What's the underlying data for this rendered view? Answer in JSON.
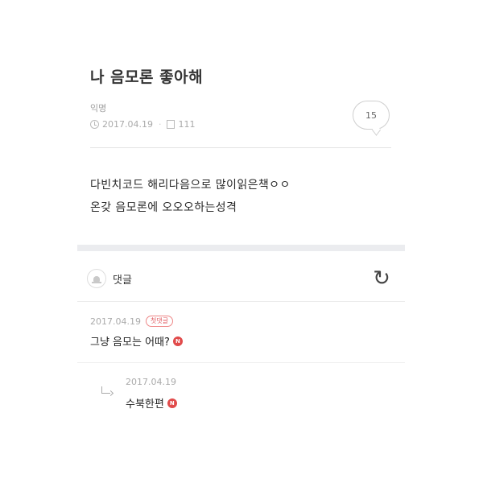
{
  "post": {
    "title": "나 음모론 좋아해",
    "author": "익명",
    "date": "2017.04.19",
    "views": "111",
    "comment_count": "15",
    "body_lines": [
      "다빈치코드 해리다음으로 많이읽은책ㅇㅇ",
      "온갖 음모론에 오오오하는성격"
    ]
  },
  "comments_section": {
    "label": "댓글",
    "icons": {
      "bell": "bell-icon",
      "refresh": "refresh-icon",
      "new": "new-badge-icon",
      "reply": "reply-arrow-icon"
    },
    "n_label": "N",
    "comment": {
      "date": "2017.04.19",
      "badge": "첫댓글",
      "text": "그냥 음모는 어때?"
    },
    "reply": {
      "date": "2017.04.19",
      "text": "수북한편"
    }
  },
  "colors": {
    "badge_red": "#e14b4b",
    "divider": "#ebecef"
  }
}
